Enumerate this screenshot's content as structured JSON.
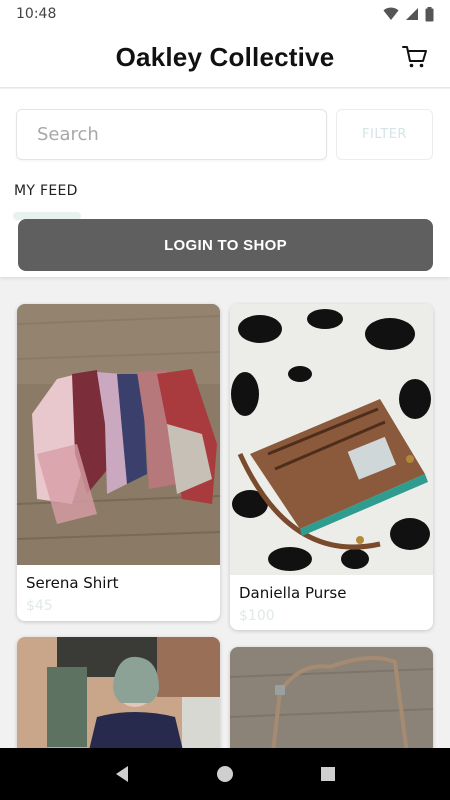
{
  "status_bar": {
    "time": "10:48"
  },
  "header": {
    "title": "Oakley Collective",
    "cart_icon": "cart-icon"
  },
  "search": {
    "placeholder": "Search",
    "value": ""
  },
  "filter": {
    "label": "FILTER"
  },
  "feed": {
    "label": "MY FEED"
  },
  "login": {
    "label": "LOGIN TO SHOP"
  },
  "products": [
    {
      "name": "Serena Shirt",
      "price": "$45",
      "image": "stack of flannel shirts on wood floor"
    },
    {
      "name": "Daniella Purse",
      "price": "$100",
      "image": "brown leather purse on cow print"
    },
    {
      "name": "",
      "price": "",
      "image": "woman with gray hair standing in doorway"
    },
    {
      "name": "",
      "price": "",
      "image": "leather strap on wood floor"
    }
  ],
  "colors": {
    "primary_button": "#5f5f5f",
    "muted_accent": "#dfe9ea",
    "nav_bar": "#000000"
  },
  "nav": {
    "back_icon": "back-icon",
    "home_icon": "home-icon",
    "recents_icon": "recents-icon"
  }
}
